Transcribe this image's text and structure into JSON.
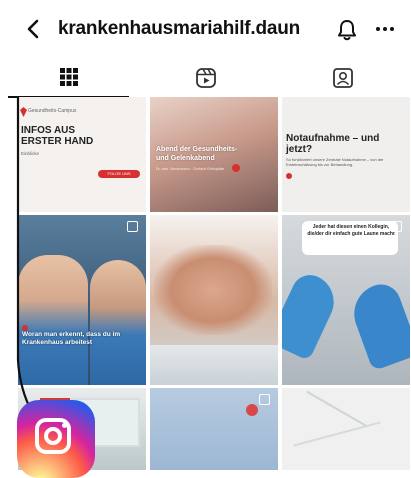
{
  "header": {
    "username": "krankenhausmariahilf.daun"
  },
  "tiles": {
    "t1": {
      "brand": "Gesundheits-Campus",
      "headline": "INFOS AUS ERSTER HAND",
      "subline": "Einblicke",
      "button": "FOLGE UNS"
    },
    "t2": {
      "overlay": "Abend der Gesundheits- und Gelenkabend",
      "meta": "Dr. med. Mustermann · Chefarzt Orthopädie"
    },
    "t3": {
      "headline": "Notaufnahme – und jetzt?",
      "body": "So funktioniert unsere Zentrale Notaufnahme – von der Ersteinschätzung bis zur Behandlung."
    },
    "t4": {
      "caption": "Woran man erkennt, dass du im Krankenhaus arbeitest"
    },
    "t6": {
      "bubble": "Jeder hat diesen einen Kollegin, die/der dir einfach gute Laune macht"
    }
  }
}
